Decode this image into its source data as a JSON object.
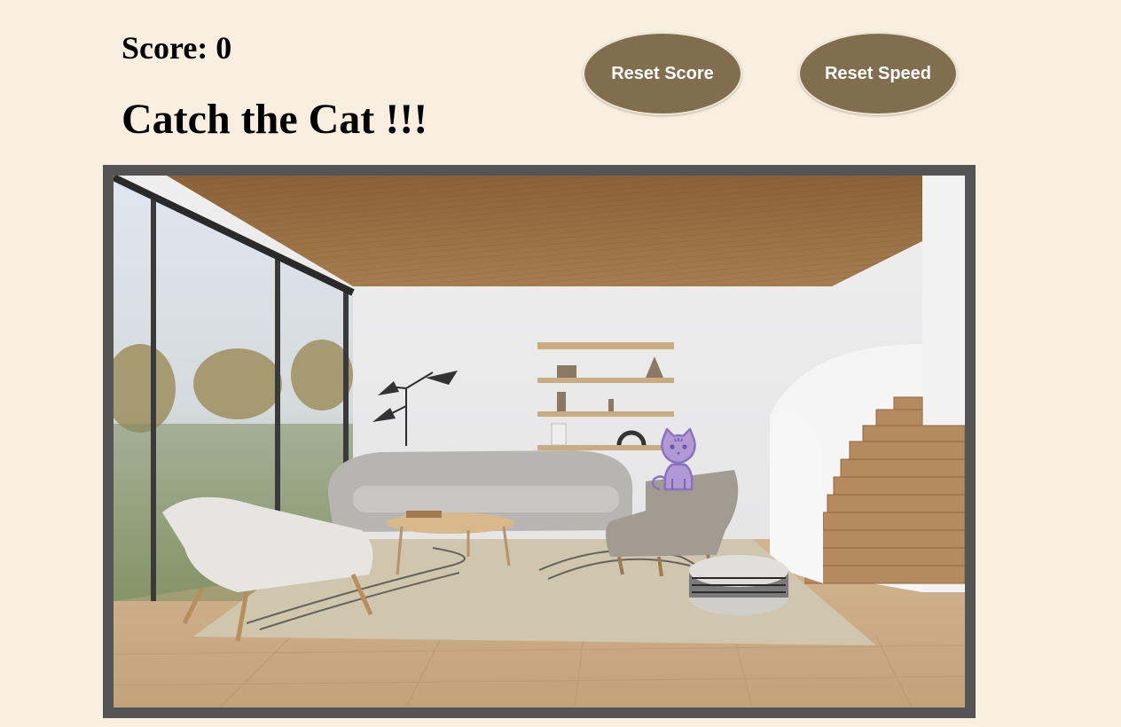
{
  "header": {
    "score_label": "Score: 0",
    "title": "Catch the Cat !!!"
  },
  "buttons": {
    "reset_score_label": "Reset Score",
    "reset_speed_label": "Reset Speed"
  },
  "colors": {
    "background": "#f8efe0",
    "button": "#806e4e",
    "frame": "#545454",
    "cat": "#b09ad6",
    "cat_outline": "#8a72c0"
  },
  "game": {
    "scene": "living-room",
    "target_icon": "cat-icon"
  }
}
